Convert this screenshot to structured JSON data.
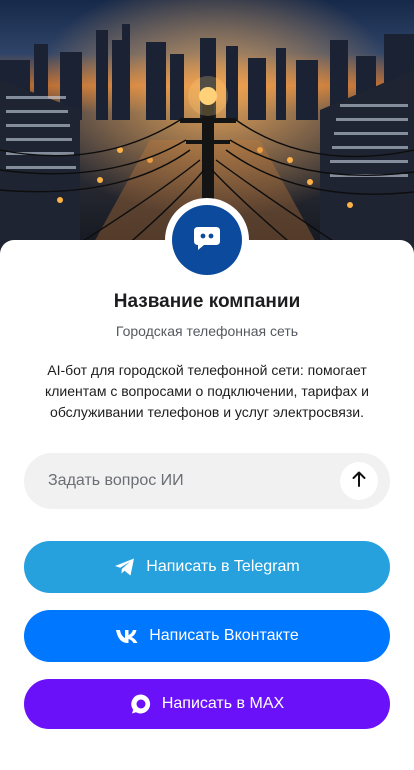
{
  "colors": {
    "accent_avatar": "#0b4a9c",
    "telegram": "#27a1de",
    "vkontakte": "#0077ff",
    "max": "#6a11fa"
  },
  "hero": {
    "image": "city-night-power-lines-photo"
  },
  "company": {
    "avatar_icon": "chat-bot-icon",
    "name": "Название компании",
    "tagline": "Городская телефонная сеть",
    "description": "AI-бот для городской телефонной сети: помогает клиентам с вопросами о подключении, тарифах и обслуживании телефонов и услуг электросвязи."
  },
  "ask": {
    "placeholder": "Задать вопрос ИИ",
    "value": "",
    "send_icon": "arrow-up-icon"
  },
  "buttons": {
    "telegram": {
      "label": "Написать в Telegram",
      "icon": "telegram-icon"
    },
    "vkontakte": {
      "label": "Написать Вконтакте",
      "icon": "vk-icon"
    },
    "max": {
      "label": "Написать в MAX",
      "icon": "max-icon"
    }
  }
}
